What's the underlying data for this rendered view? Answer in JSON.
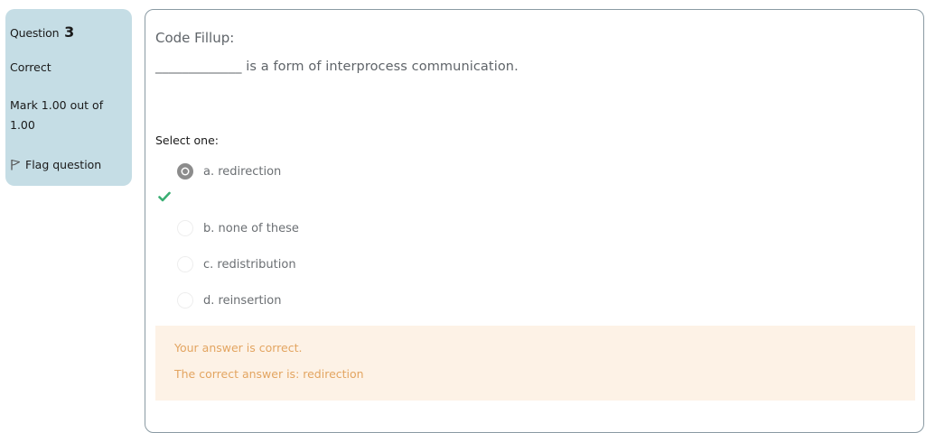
{
  "info": {
    "question_label": "Question",
    "question_number": "3",
    "state": "Correct",
    "grade": "Mark 1.00 out of 1.00",
    "flag_label": "Flag question",
    "flag_icon": "flag-icon"
  },
  "question": {
    "title": "Code Fillup:",
    "text": "_____________ is a form of interprocess communication.",
    "prompt": "Select one:"
  },
  "options": [
    {
      "label": "a. redirection",
      "selected": true,
      "correct": true
    },
    {
      "label": "b. none of these",
      "selected": false
    },
    {
      "label": "c. redistribution",
      "selected": false
    },
    {
      "label": "d. reinsertion",
      "selected": false
    }
  ],
  "feedback": {
    "status": "Your answer is correct.",
    "right_answer": "The correct answer is: redirection"
  },
  "colors": {
    "info_bg": "#c5dde5",
    "feedback_bg": "#fdf2e6",
    "feedback_text": "#e3a561",
    "correct_tick": "#3aae73"
  }
}
